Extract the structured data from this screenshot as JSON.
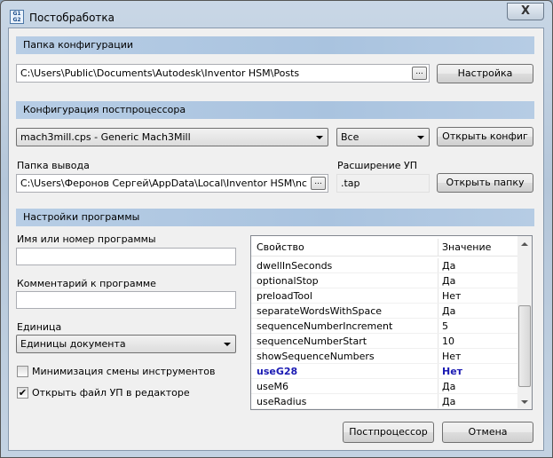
{
  "window": {
    "title": "Постобработка",
    "icon": "g1-g2-app-icon",
    "close": "X"
  },
  "config_folder": {
    "header": "Папка конфигурации",
    "path": "C:\\Users\\Public\\Documents\\Autodesk\\Inventor HSM\\Posts",
    "browse": "...",
    "setup_button": "Настройка"
  },
  "post_config": {
    "header": "Конфигурация постпроцессора",
    "post_select": "mach3mill.cps - Generic Mach3Mill",
    "filter_select": "Все",
    "open_config_button": "Открыть конфиг"
  },
  "output": {
    "folder_label": "Папка вывода",
    "folder_path": "C:\\Users\\Феронов Сергей\\AppData\\Local\\Inventor HSM\\nc",
    "browse": "...",
    "ext_label": "Расширение УП",
    "ext_value": ".tap",
    "open_folder_button": "Открыть папку"
  },
  "program": {
    "header": "Настройки программы",
    "name_label": "Имя или номер программы",
    "name_value": "",
    "comment_label": "Комментарий к программе",
    "comment_value": "",
    "unit_label": "Единица",
    "unit_select": "Единицы документа",
    "minimize_tool_changes": {
      "label": "Минимизация смены инструментов",
      "checked": false
    },
    "open_in_editor": {
      "label": "Открыть файл УП в редакторе",
      "checked": true
    }
  },
  "properties": {
    "col_property": "Свойство",
    "col_value": "Значение",
    "highlight_color": "#1a1ab3",
    "rows": [
      {
        "name": "dwellInSeconds",
        "value": "Да"
      },
      {
        "name": "optionalStop",
        "value": "Да"
      },
      {
        "name": "preloadTool",
        "value": "Нет"
      },
      {
        "name": "separateWordsWithSpace",
        "value": "Да"
      },
      {
        "name": "sequenceNumberIncrement",
        "value": "5"
      },
      {
        "name": "sequenceNumberStart",
        "value": "10"
      },
      {
        "name": "showSequenceNumbers",
        "value": "Нет"
      },
      {
        "name": "useG28",
        "value": "Нет",
        "modified": true
      },
      {
        "name": "useM6",
        "value": "Да"
      },
      {
        "name": "useRadius",
        "value": "Да"
      }
    ]
  },
  "footer": {
    "post_button": "Постпроцессор",
    "cancel_button": "Отмена"
  }
}
